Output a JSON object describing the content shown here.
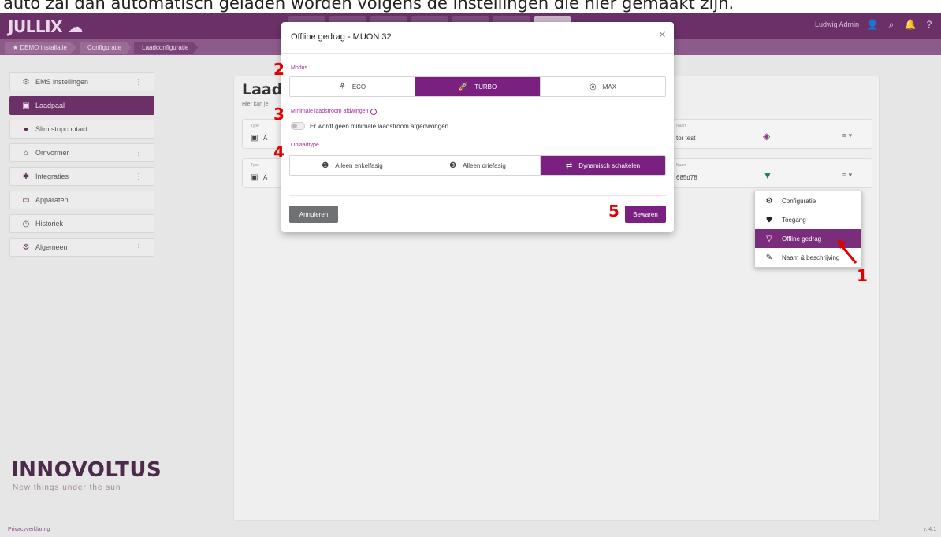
{
  "caption": "auto zal dan automatisch geladen worden volgens de instellingen die hier gemaakt zijn.",
  "header": {
    "logo": "JULLIX",
    "logo_icon": "cloud-logo-icon",
    "user_name": "Ludwig Admin",
    "icons": [
      "user-icon",
      "search-icon",
      "bell-icon",
      "help-icon"
    ]
  },
  "breadcrumb": [
    "DEMO installatie",
    "Configuratie",
    "Laadconfiguratie"
  ],
  "sidebar": {
    "items": [
      {
        "label": "EMS instellingen",
        "icon": "gear-icon",
        "menu": true
      },
      {
        "label": "Laadpaal",
        "icon": "charger-icon",
        "menu": false,
        "active": true
      },
      {
        "label": "Slim stopcontact",
        "icon": "plug-icon",
        "menu": false
      },
      {
        "label": "Omvormer",
        "icon": "home-icon",
        "menu": true
      },
      {
        "label": "Integraties",
        "icon": "puzzle-icon",
        "menu": true
      },
      {
        "label": "Apparaten",
        "icon": "device-icon",
        "menu": false
      },
      {
        "label": "Historiek",
        "icon": "history-icon",
        "menu": false
      },
      {
        "label": "Algemeen",
        "icon": "settings-icon",
        "menu": true
      }
    ]
  },
  "brand": {
    "name": "INNOVOLTUS",
    "tagline": "New things under the sun"
  },
  "main": {
    "title": "Laadp",
    "subtitle": "Hier kan je",
    "rows": [
      {
        "label_left": "Type",
        "value_left": "A",
        "label_right": "Naam",
        "value_right": "tor test",
        "status": "tag-icon"
      },
      {
        "label_left": "Type",
        "value_left": "A",
        "label_right": "Naam",
        "value_right": "685d78",
        "status": "wifi-icon"
      }
    ]
  },
  "context_menu": [
    {
      "label": "Configuratie",
      "icon": "gear-icon"
    },
    {
      "label": "Toegang",
      "icon": "shield-icon"
    },
    {
      "label": "Offline gedrag",
      "icon": "wifi-off-icon",
      "active": true
    },
    {
      "label": "Naam & beschrijving",
      "icon": "tag-icon"
    }
  ],
  "modal": {
    "title": "Offline gedrag - MUON 32",
    "close": "×",
    "modus_label": "Modus",
    "modus_options": [
      {
        "label": "ECO",
        "icon": "eco-icon"
      },
      {
        "label": "TURBO",
        "icon": "rocket-icon",
        "active": true
      },
      {
        "label": "MAX",
        "icon": "gauge-icon"
      }
    ],
    "min_current_label": "Minimale laadstroom afdwingen",
    "min_current_text": "Er wordt geen minimale laadstroom afgedwongen.",
    "laadtype_label": "Oplaadtype",
    "laadtype_options": [
      {
        "label": "Alleen enkelfasig",
        "icon": "one-icon"
      },
      {
        "label": "Alleen driefasig",
        "icon": "three-icon"
      },
      {
        "label": "Dynamisch schakelen",
        "icon": "switch-icon",
        "active": true
      }
    ],
    "cancel_label": "Annuleren",
    "save_label": "Bewaren"
  },
  "annotations": [
    "1",
    "2",
    "3",
    "4",
    "5"
  ],
  "footer": {
    "left": "Privacyverklaring",
    "right": "v. 4.1"
  },
  "colors": {
    "brand": "#6b3068",
    "accent": "#7a2080",
    "annotation": "#e10000"
  }
}
